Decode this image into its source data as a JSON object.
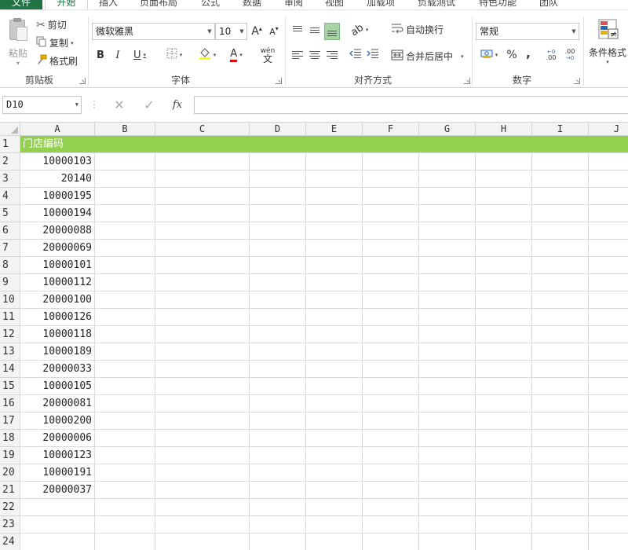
{
  "tabs": [
    {
      "label": "文件"
    },
    {
      "label": "开始"
    },
    {
      "label": "插入"
    },
    {
      "label": "页面布局"
    },
    {
      "label": "公式"
    },
    {
      "label": "数据"
    },
    {
      "label": "审阅"
    },
    {
      "label": "视图"
    },
    {
      "label": "加载项"
    },
    {
      "label": "负载测试"
    },
    {
      "label": "特色功能"
    },
    {
      "label": "团队"
    }
  ],
  "ribbon": {
    "clipboard": {
      "paste": "粘贴",
      "cut": "剪切",
      "copy": "复制",
      "format_painter": "格式刷",
      "group": "剪贴板"
    },
    "font": {
      "name": "微软雅黑",
      "size": "10",
      "bold": "B",
      "italic": "I",
      "underline": "U",
      "phonetic": "wén",
      "phonetic_char": "文",
      "font_color": "A",
      "grow": "A",
      "shrink": "A",
      "group": "字体"
    },
    "alignment": {
      "wrap_text": "自动换行",
      "merge_center": "合并后居中",
      "group": "对齐方式"
    },
    "number": {
      "format": "常规",
      "percent": "%",
      "comma": ",",
      "increase_decimal": ".00",
      "decrease_decimal": ".00",
      "group": "数字"
    },
    "styles": {
      "conditional": "条件格式"
    }
  },
  "formula_bar": {
    "name_box": "D10",
    "cancel": "✕",
    "enter": "✓",
    "fx": "fx",
    "value": ""
  },
  "columns": [
    "A",
    "B",
    "C",
    "D",
    "E",
    "F",
    "G",
    "H",
    "I",
    "J"
  ],
  "rows": [
    "1",
    "2",
    "3",
    "4",
    "5",
    "6",
    "7",
    "8",
    "9",
    "10",
    "11",
    "12",
    "13",
    "14",
    "15",
    "16",
    "17",
    "18",
    "19",
    "20",
    "21",
    "22",
    "23",
    "24"
  ],
  "sheet": {
    "header": "门店编码",
    "header_fill": "#92d050",
    "values": [
      "10000103",
      "20140",
      "10000195",
      "10000194",
      "20000088",
      "20000069",
      "10000101",
      "10000112",
      "20000100",
      "10000126",
      "10000118",
      "10000189",
      "20000033",
      "10000105",
      "20000081",
      "10000200",
      "20000006",
      "10000123",
      "10000191",
      "20000037"
    ]
  },
  "colors": {
    "accent": "#217346",
    "header_fill": "#92d050"
  }
}
